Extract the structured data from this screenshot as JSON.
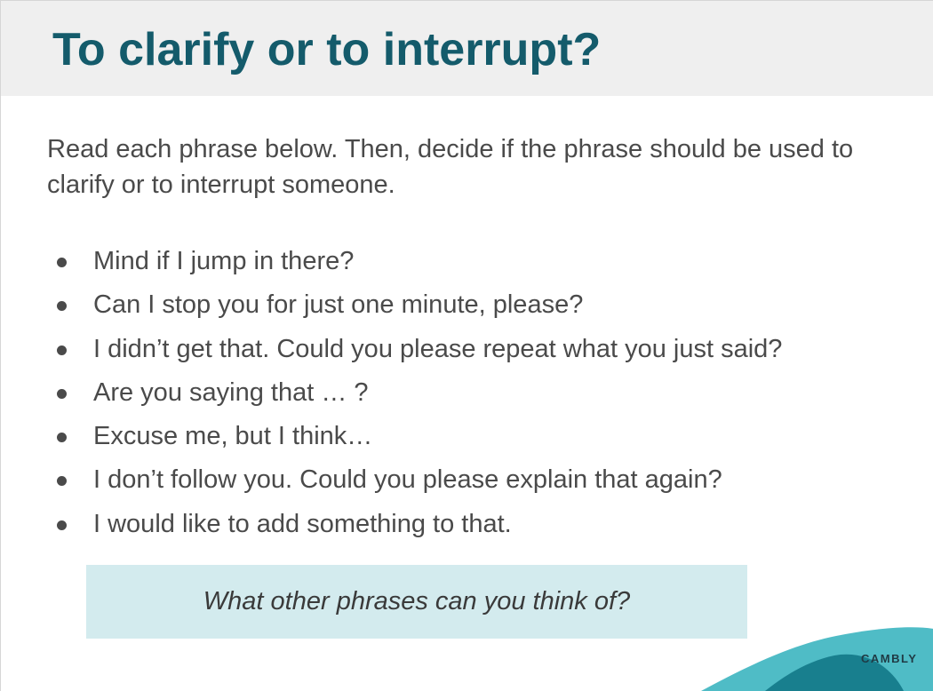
{
  "slide": {
    "title": "To clarify or to interrupt?",
    "instructions": "Read each phrase below. Then, decide if the phrase should be used to clarify or to interrupt someone.",
    "phrases": [
      "Mind if I jump in there?",
      "Can I stop you for just one minute, please?",
      "I didn’t get that. Could you please repeat what you just said?",
      "Are you saying that … ?",
      "Excuse me, but I think…",
      "I don’t follow you. Could you please explain that again?",
      "I would like to add something to that."
    ],
    "prompt": "What other phrases can you think of?",
    "brand": "CAMBLY"
  },
  "colors": {
    "title": "#145b6b",
    "header_bg": "#efefef",
    "body_text": "#4a4a4a",
    "prompt_bg": "#d3ebee",
    "logo_light": "#4fbcc6",
    "logo_dark": "#187f8e"
  }
}
